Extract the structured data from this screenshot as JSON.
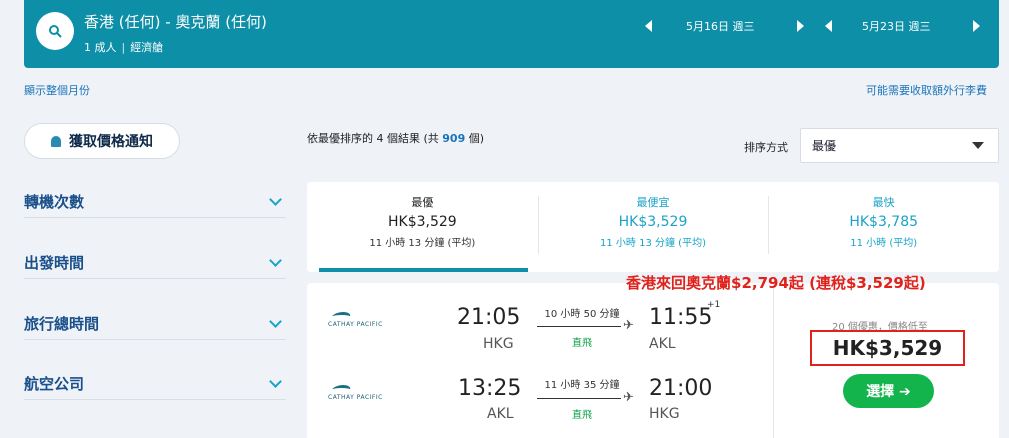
{
  "header": {
    "route": "香港 (任何) - 奧克蘭 (任何)",
    "passengers": "1 成人",
    "cabin": "經濟艙",
    "depart_date": "5月16日 週三",
    "return_date": "5月23日 週三"
  },
  "links": {
    "show_month": "顯示整個月份",
    "extra_fees": "可能需要收取額外行李費"
  },
  "sidebar": {
    "price_alert": "獲取價格通知",
    "filters": [
      "轉機次數",
      "出發時間",
      "旅行總時間",
      "航空公司"
    ]
  },
  "results": {
    "prefix": "依最優排序的 4 個結果 (共 ",
    "total": "909",
    "suffix": " 個)"
  },
  "sort": {
    "label": "排序方式",
    "value": "最優"
  },
  "tabs": [
    {
      "title": "最優",
      "price": "HK$3,529",
      "duration": "11 小時 13 分鐘 (平均)"
    },
    {
      "title": "最便宜",
      "price": "HK$3,529",
      "duration": "11 小時 13 分鐘 (平均)"
    },
    {
      "title": "最快",
      "price": "HK$3,785",
      "duration": "11 小時 (平均)"
    }
  ],
  "promo": "香港來回奧克蘭$2,794起 (連稅$3,529起)",
  "flight": {
    "airline": "CATHAY PACIFIC",
    "outbound": {
      "dep_time": "21:05",
      "dep_code": "HKG",
      "duration": "10 小時 50 分鐘",
      "stops": "直飛",
      "arr_time": "11:55",
      "day_offset": "+1",
      "arr_code": "AKL"
    },
    "inbound": {
      "dep_time": "13:25",
      "dep_code": "AKL",
      "duration": "11 小時 35 分鐘",
      "stops": "直飛",
      "arr_time": "21:00",
      "arr_code": "HKG"
    },
    "deals": "20 個優惠，價格低至",
    "price": "HK$3,529",
    "select": "選擇 ➔"
  },
  "colors": {
    "brand": "#0c8fa7",
    "accent": "#1aa3c8",
    "select": "#13b44c",
    "promo": "#e0221b"
  }
}
